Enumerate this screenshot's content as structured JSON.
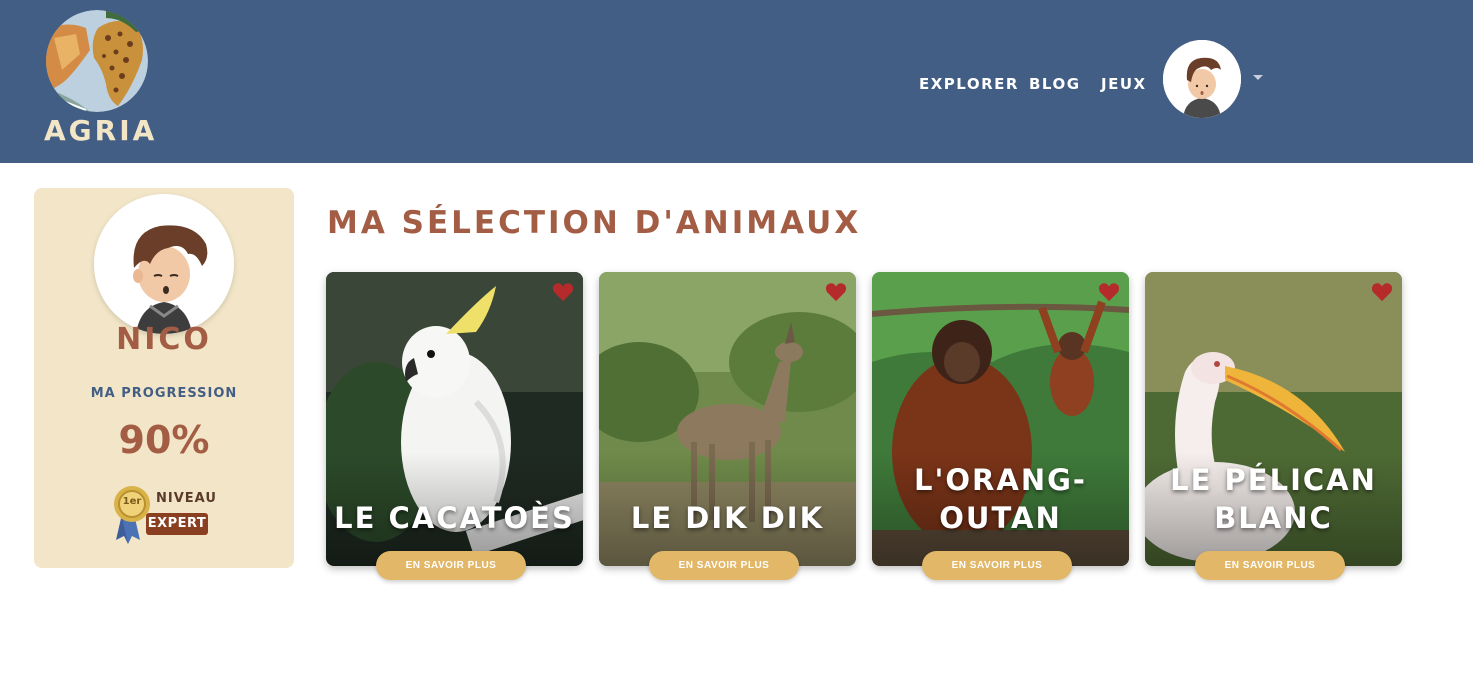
{
  "brand": {
    "name": "AGRIA",
    "logo_icon": "globe-africa-icon"
  },
  "nav": {
    "links": [
      {
        "label": "EXPLORER"
      },
      {
        "label": "BLOG"
      },
      {
        "label": "JEUX"
      }
    ],
    "avatar_icon": "user-avatar-icon",
    "caret_icon": "caret-down-icon"
  },
  "profile": {
    "name": "NICO",
    "progress_label": "MA PROGRESSION",
    "progress_value": "90%",
    "badge": {
      "rank": "1er",
      "level_label": "NIVEAU",
      "level_value": "EXPERT",
      "icon": "medal-icon"
    }
  },
  "main": {
    "title": "MA SÉLECTION D'ANIMAUX",
    "cards": [
      {
        "title_line1": "LE CACATOÈS",
        "title_line2": "",
        "button": "EN SAVOIR PLUS",
        "favorited": true
      },
      {
        "title_line1": "LE DIK DIK",
        "title_line2": "",
        "button": "EN SAVOIR PLUS",
        "favorited": true
      },
      {
        "title_line1": "L'ORANG-",
        "title_line2": "OUTAN",
        "button": "EN SAVOIR PLUS",
        "favorited": true
      },
      {
        "title_line1": "LE PÉLICAN",
        "title_line2": "BLANC",
        "button": "EN SAVOIR PLUS",
        "favorited": true
      }
    ]
  },
  "colors": {
    "header_bg": "#435e84",
    "accent_brown": "#a35d45",
    "profile_bg": "#f3e6c8",
    "button_gold": "#e2b767",
    "heart_red": "#b52a2a"
  }
}
